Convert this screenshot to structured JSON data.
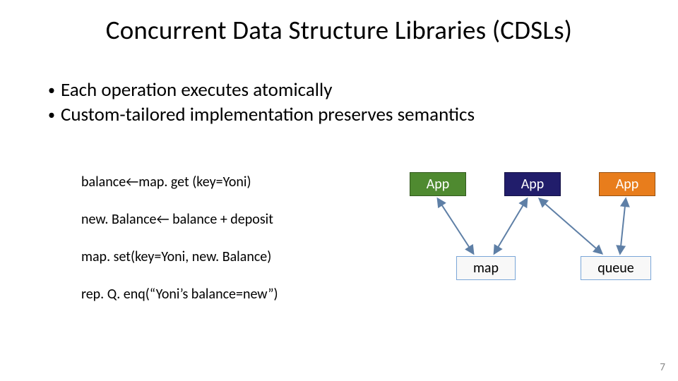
{
  "title": "Concurrent Data Structure Libraries (CDSLs)",
  "bullets": [
    "Each operation executes atomically",
    "Custom-tailored implementation preserves semantics"
  ],
  "code": {
    "l1": "balance←map. get (key=Yoni)",
    "l2": "new. Balance← balance + deposit",
    "l3": "map. set(key=Yoni, new. Balance)",
    "l4": "rep. Q. enq(“Yoni’s balance=new”)"
  },
  "boxes": {
    "app1": "App",
    "app2": "App",
    "app3": "App",
    "map": "map",
    "queue": "queue"
  },
  "page_number": "7",
  "colors": {
    "app_green": "#4f8a30",
    "app_navy": "#211d6b",
    "app_orange": "#e87d1c",
    "ds_border": "#7aa6d8",
    "arrow_stroke": "#5e7fa6"
  }
}
